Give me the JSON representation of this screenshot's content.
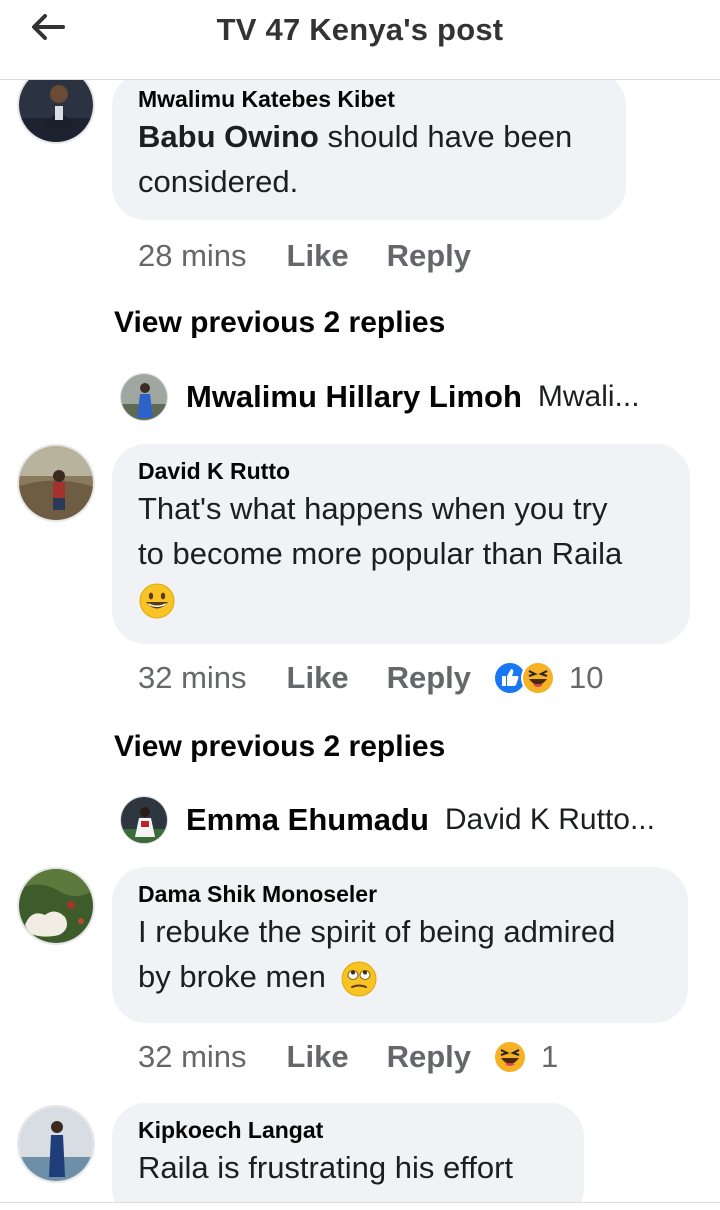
{
  "header": {
    "title": "TV 47 Kenya's post"
  },
  "comments": [
    {
      "author": "Mwalimu Katebes Kibet",
      "bold_prefix": "Babu Owino",
      "text_line1": " should have been",
      "text_line2": "considered.",
      "time": "28 mins",
      "like": "Like",
      "reply": "Reply"
    },
    {
      "author": "David K Rutto",
      "text_line1": "That's what happens when you try",
      "text_line2": "to become more popular than Raila",
      "time": "32 mins",
      "like": "Like",
      "reply": "Reply",
      "reaction_count": "10"
    },
    {
      "author": "Dama Shik Monoseler",
      "text_line1": "I rebuke the spirit of being admired",
      "text_line2": "by broke men",
      "time": "32 mins",
      "like": "Like",
      "reply": "Reply",
      "reaction_count": "1"
    },
    {
      "author": "Kipkoech Langat",
      "text_line1": "Raila is frustrating his effort"
    }
  ],
  "view_previous": [
    "View previous 2 replies",
    "View previous 2 replies"
  ],
  "reply_previews": [
    {
      "name": "Mwalimu Hillary Limoh",
      "snippet": "Mwali..."
    },
    {
      "name": "Emma Ehumadu",
      "snippet": "David K Rutto..."
    }
  ],
  "colors": {
    "bubble": "#f0f2f5",
    "meta": "#65676b",
    "like_blue": "#1877f2",
    "haha_yellow": "#f7b125"
  },
  "icons": [
    "back-arrow-icon",
    "like-reaction-icon",
    "haha-reaction-icon",
    "grin-emoji-icon",
    "eye-roll-emoji-icon"
  ]
}
